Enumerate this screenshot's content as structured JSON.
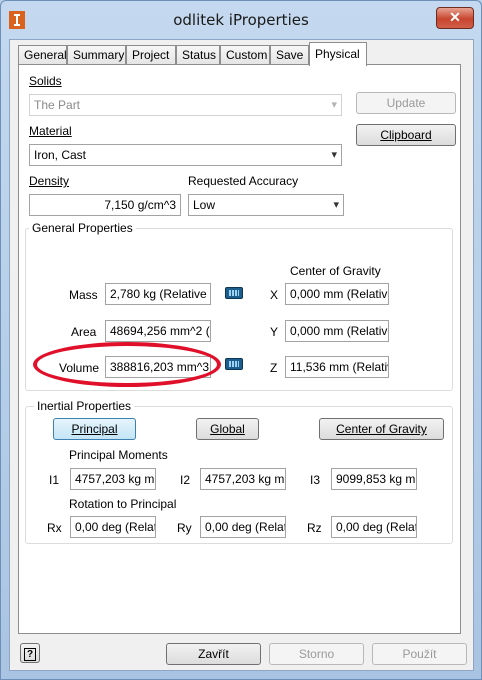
{
  "window": {
    "title": "odlitek iProperties",
    "close_glyph": "✕"
  },
  "tabs": [
    "General",
    "Summary",
    "Project",
    "Status",
    "Custom",
    "Save",
    "Physical"
  ],
  "solids": {
    "label": "Solids",
    "value": "The Part",
    "update_label": "Update",
    "clipboard_label": "Clipboard"
  },
  "material": {
    "label": "Material",
    "value": "Iron, Cast"
  },
  "density": {
    "label": "Density",
    "value": "7,150 g/cm^3"
  },
  "accuracy": {
    "label": "Requested Accuracy",
    "value": "Low"
  },
  "general_properties": {
    "title": "General Properties",
    "center_of_gravity_label": "Center of Gravity",
    "mass": {
      "label": "Mass",
      "value": "2,780 kg (Relative E"
    },
    "area": {
      "label": "Area",
      "value": "48694,256 mm^2 ("
    },
    "volume": {
      "label": "Volume",
      "value": "388816,203 mm^3"
    },
    "x": {
      "label": "X",
      "value": "0,000 mm (Relative"
    },
    "y": {
      "label": "Y",
      "value": "0,000 mm (Relative"
    },
    "z": {
      "label": "Z",
      "value": "11,536 mm (Relativ"
    }
  },
  "inertial_properties": {
    "title": "Inertial Properties",
    "principal_label": "Principal",
    "global_label": "Global",
    "cog_label": "Center of Gravity",
    "principal_moments_label": "Principal Moments",
    "i1": {
      "label": "I1",
      "value": "4757,203 kg mr"
    },
    "i2": {
      "label": "I2",
      "value": "4757,203 kg mr"
    },
    "i3": {
      "label": "I3",
      "value": "9099,853 kg mr"
    },
    "rotation_label": "Rotation to Principal",
    "rx": {
      "label": "Rx",
      "value": "0,00 deg (Relat"
    },
    "ry": {
      "label": "Ry",
      "value": "0,00 deg (Relat"
    },
    "rz": {
      "label": "Rz",
      "value": "0,00 deg (Relat"
    }
  },
  "footer": {
    "help_glyph": "?",
    "close_label": "Zavřít",
    "cancel_label": "Storno",
    "apply_label": "Použít"
  }
}
